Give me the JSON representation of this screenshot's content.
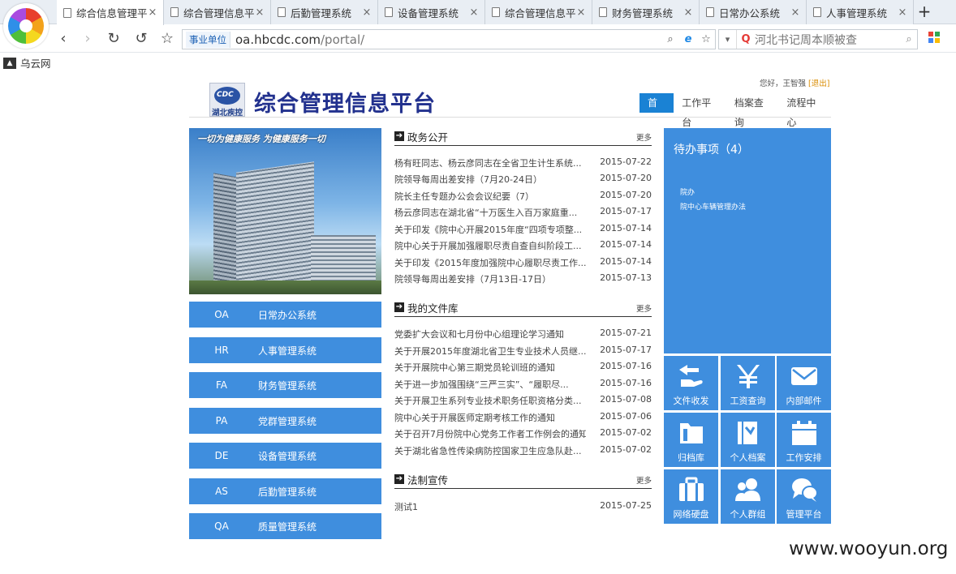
{
  "browser": {
    "tabs": [
      {
        "label": "综合信息管理平",
        "active": true
      },
      {
        "label": "综合管理信息平",
        "active": false
      },
      {
        "label": "后勤管理系统",
        "active": false
      },
      {
        "label": "设备管理系统",
        "active": false
      },
      {
        "label": "综合管理信息平",
        "active": false
      },
      {
        "label": "财务管理系统",
        "active": false
      },
      {
        "label": "日常办公系统",
        "active": false
      },
      {
        "label": "人事管理系统",
        "active": false
      }
    ],
    "close_glyph": "×",
    "new_tab_glyph": "+",
    "nav": {
      "back": "‹",
      "forward": "›",
      "reload": "↻",
      "undo": "↺",
      "bookmark": "☆"
    },
    "address": {
      "badge": "事业单位",
      "host": "oa.hbcdc.com",
      "path": "/portal/"
    },
    "search": {
      "text": "河北书记周本顺被查"
    },
    "bookmark_bar": [
      {
        "label": "乌云网"
      }
    ]
  },
  "header": {
    "greeting": "您好，王智强",
    "logout": "[退出]",
    "logo_sub": "湖北疾控",
    "logo_abbr": "CDC",
    "title": "综合管理信息平台",
    "nav": [
      {
        "label": "首页",
        "active": true
      },
      {
        "label": "工作平台",
        "active": false
      },
      {
        "label": "档案查询",
        "active": false
      },
      {
        "label": "流程中心",
        "active": false
      }
    ]
  },
  "banner": {
    "slogan": "一切为健康服务 为健康服务一切"
  },
  "systems": [
    {
      "code": "OA",
      "name": "日常办公系统"
    },
    {
      "code": "HR",
      "name": "人事管理系统"
    },
    {
      "code": "FA",
      "name": "财务管理系统"
    },
    {
      "code": "PA",
      "name": "党群管理系统"
    },
    {
      "code": "DE",
      "name": "设备管理系统"
    },
    {
      "code": "AS",
      "name": "后勤管理系统"
    },
    {
      "code": "QA",
      "name": "质量管理系统"
    }
  ],
  "sections": [
    {
      "title": "政务公开",
      "more": "更多",
      "items": [
        {
          "title": "杨有旺同志、杨云彦同志在全省卫生计生系统...",
          "date": "2015-07-22"
        },
        {
          "title": "院领导每周出差安排（7月20-24日）",
          "date": "2015-07-20"
        },
        {
          "title": "院长主任专题办公会会议纪要（7）",
          "date": "2015-07-20"
        },
        {
          "title": "杨云彦同志在湖北省“十万医生入百万家庭重...",
          "date": "2015-07-17"
        },
        {
          "title": "关于印发《院中心开展2015年度“四项专项整...",
          "date": "2015-07-14"
        },
        {
          "title": "院中心关于开展加强履职尽责自查自纠阶段工...",
          "date": "2015-07-14"
        },
        {
          "title": "关于印发《2015年度加强院中心履职尽责工作...",
          "date": "2015-07-14"
        },
        {
          "title": "院领导每周出差安排（7月13日-17日）",
          "date": "2015-07-13"
        }
      ]
    },
    {
      "title": "我的文件库",
      "more": "更多",
      "items": [
        {
          "title": "党委扩大会议和七月份中心组理论学习通知",
          "date": "2015-07-21"
        },
        {
          "title": "关于开展2015年度湖北省卫生专业技术人员继...",
          "date": "2015-07-17"
        },
        {
          "title": "关于开展院中心第三期党员轮训班的通知",
          "date": "2015-07-16"
        },
        {
          "title": "关于进一步加强围绕“三严三实”、“履职尽...",
          "date": "2015-07-16"
        },
        {
          "title": "关于开展卫生系列专业技术职务任职资格分类...",
          "date": "2015-07-08"
        },
        {
          "title": "院中心关于开展医师定期考核工作的通知",
          "date": "2015-07-06"
        },
        {
          "title": "关于召开7月份院中心党务工作者工作例会的通知",
          "date": "2015-07-02"
        },
        {
          "title": "关于湖北省急性传染病防控国家卫生应急队赴...",
          "date": "2015-07-02"
        }
      ]
    },
    {
      "title": "法制宣传",
      "more": "更多",
      "items": [
        {
          "title": "测试1",
          "date": "2015-07-25"
        }
      ]
    }
  ],
  "todo": {
    "title": "待办事项（4）",
    "items": [
      "院办",
      "院中心车辆管理办法"
    ]
  },
  "tiles": [
    {
      "label": "文件收发",
      "icon": "hand-arrow-icon"
    },
    {
      "label": "工资查询",
      "icon": "yen-icon"
    },
    {
      "label": "内部邮件",
      "icon": "envelope-icon"
    },
    {
      "label": "归档库",
      "icon": "folder-icon"
    },
    {
      "label": "个人档案",
      "icon": "profile-book-icon"
    },
    {
      "label": "工作安排",
      "icon": "calendar-icon"
    },
    {
      "label": "网络硬盘",
      "icon": "briefcase-icon"
    },
    {
      "label": "个人群组",
      "icon": "group-icon"
    },
    {
      "label": "管理平台",
      "icon": "chat-icon"
    }
  ],
  "watermark": "www.wooyun.org",
  "colors": {
    "accent": "#3f8ede",
    "nav_active": "#1a82d4",
    "title": "#22318e"
  }
}
